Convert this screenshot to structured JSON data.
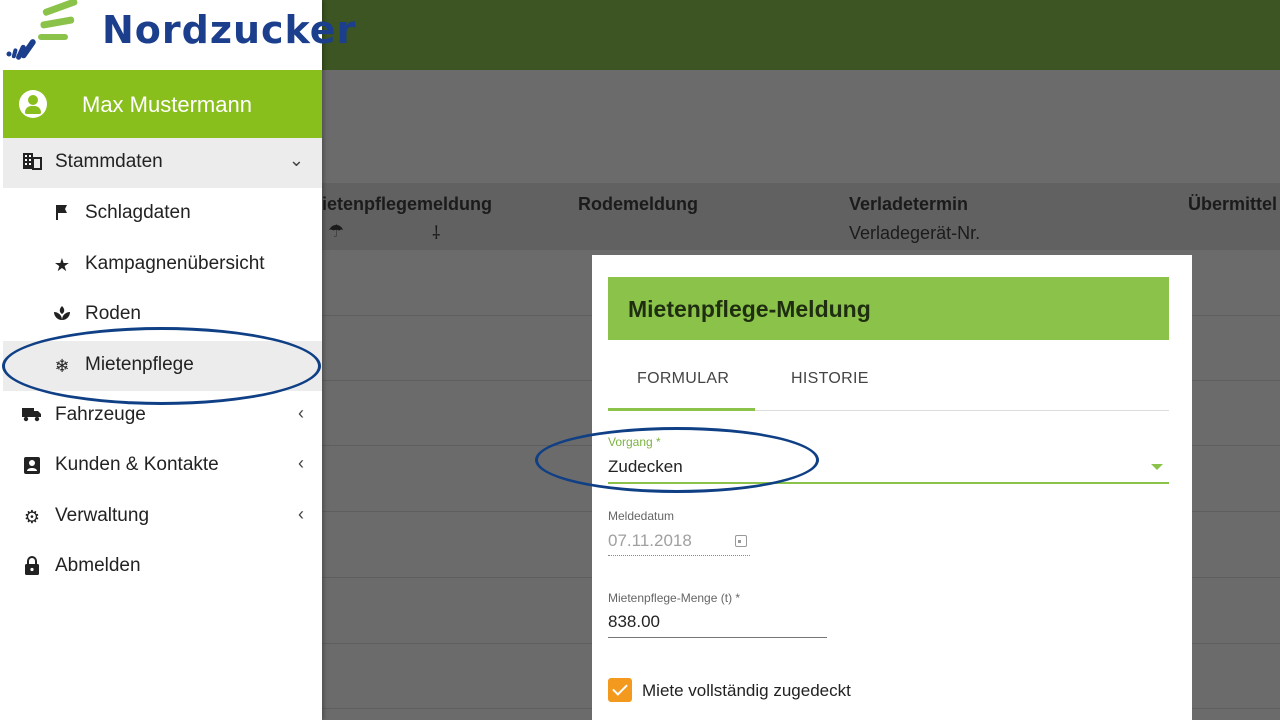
{
  "brand": {
    "logo_text": "Nordzucker",
    "primary_green": "#89bf1c",
    "dark_green": "#3c5522",
    "logo_blue": "#1b3f8c",
    "checkbox_orange": "#f39a1e",
    "annotation_blue": "#0f3f85"
  },
  "user": {
    "name": "Max Mustermann",
    "icon": "account-circle-icon"
  },
  "sidebar": {
    "items": [
      {
        "label": "Stammdaten",
        "icon": "building-icon",
        "chevron": "⌄"
      },
      {
        "label": "Schlagdaten",
        "icon": "flag-icon"
      },
      {
        "label": "Kampagnenübersicht",
        "icon": "star-icon"
      },
      {
        "label": "Roden",
        "icon": "sprout-icon"
      },
      {
        "label": "Mietenpflege",
        "icon": "snowflake-icon"
      },
      {
        "label": "Fahrzeuge",
        "icon": "truck-icon",
        "chevron": "‹"
      },
      {
        "label": "Kunden & Kontakte",
        "icon": "contact-card-icon",
        "chevron": "‹"
      },
      {
        "label": "Verwaltung",
        "icon": "gear-icon",
        "chevron": "‹"
      },
      {
        "label": "Abmelden",
        "icon": "lock-icon"
      }
    ]
  },
  "background_table": {
    "columns": [
      "ietenpflegemeldung",
      "Rodemeldung",
      "Verladetermin",
      "Übermittel"
    ],
    "sub": {
      "verladetermin": "Verladegerät-Nr."
    },
    "glyphs": [
      "☂",
      "⸸"
    ]
  },
  "dialog": {
    "title": "Mietenpflege-Meldung",
    "tabs": [
      "FORMULAR",
      "HISTORIE"
    ],
    "active_tab": "FORMULAR",
    "vorgang": {
      "label": "Vorgang *",
      "value": "Zudecken"
    },
    "meldedatum": {
      "label": "Meldedatum",
      "value": "07.11.2018"
    },
    "menge": {
      "label": "Mietenpflege-Menge (t) *",
      "value": "838.00"
    },
    "checkbox": {
      "label": "Miete vollständig zugedeckt",
      "checked": true
    }
  }
}
